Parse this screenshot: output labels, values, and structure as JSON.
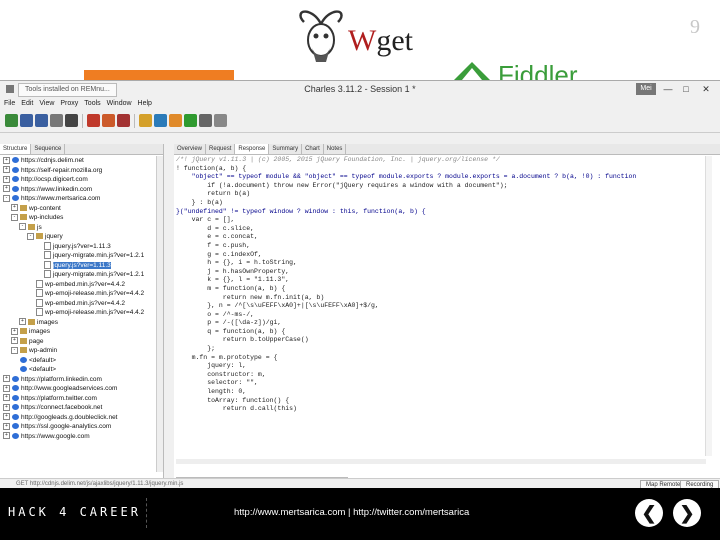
{
  "slide": {
    "logo_top": "Wget",
    "logo_right": "Fiddler",
    "slide_number": "9"
  },
  "window": {
    "tab_label": "Tools installed on REMnu...",
    "title": "Charles 3.11.2 - Session 1 *",
    "user_badge": "Mei",
    "controls": [
      "—",
      "□",
      "✕"
    ]
  },
  "menu": [
    "File",
    "Edit",
    "View",
    "Proxy",
    "Tools",
    "Window",
    "Help"
  ],
  "toolbar_icons": [
    {
      "name": "new-session-icon",
      "color": "#3a8a3a"
    },
    {
      "name": "open-session-icon",
      "color": "#3a5fa0"
    },
    {
      "name": "save-session-icon",
      "color": "#3a5fa0"
    },
    {
      "name": "trash-icon",
      "color": "#777777"
    },
    {
      "name": "binoculars-icon",
      "color": "#444444"
    },
    {
      "name": "sep"
    },
    {
      "name": "record-icon",
      "color": "#c0392b"
    },
    {
      "name": "throttle-icon",
      "color": "#cc5a2a"
    },
    {
      "name": "stop-icon",
      "color": "#a33333"
    },
    {
      "name": "sep"
    },
    {
      "name": "edit-icon",
      "color": "#d4a02a"
    },
    {
      "name": "repeat-icon",
      "color": "#2b7bb9"
    },
    {
      "name": "pencil-icon",
      "color": "#e08a2a"
    },
    {
      "name": "validate-icon",
      "color": "#2f9a2f"
    },
    {
      "name": "tools-icon",
      "color": "#666666"
    },
    {
      "name": "settings-icon",
      "color": "#888888"
    }
  ],
  "left_tabs": [
    "Structure",
    "Sequence"
  ],
  "tree": [
    {
      "d": 0,
      "e": "+",
      "i": "globe",
      "t": "https://cdnjs.delim.net"
    },
    {
      "d": 0,
      "e": "+",
      "i": "globe",
      "t": "https://self-repair.mozilla.org"
    },
    {
      "d": 0,
      "e": "+",
      "i": "globe",
      "t": "http://ocsp.digicert.com"
    },
    {
      "d": 0,
      "e": "+",
      "i": "globe",
      "t": "https://www.linkedin.com"
    },
    {
      "d": 0,
      "e": "-",
      "i": "globe",
      "t": "https://www.mertsarica.com"
    },
    {
      "d": 1,
      "e": "+",
      "i": "folder",
      "t": "wp-content"
    },
    {
      "d": 1,
      "e": "-",
      "i": "folder",
      "t": "wp-includes"
    },
    {
      "d": 2,
      "e": "-",
      "i": "folder",
      "t": "js"
    },
    {
      "d": 3,
      "e": "-",
      "i": "folder",
      "t": "jquery"
    },
    {
      "d": 4,
      "e": "",
      "i": "file",
      "t": "jquery.js?ver=1.11.3"
    },
    {
      "d": 4,
      "e": "",
      "i": "file",
      "t": "jquery-migrate.min.js?ver=1.2.1"
    },
    {
      "d": 4,
      "e": "",
      "i": "file",
      "t": "jquery.js?ver=1.11.3",
      "sel": true
    },
    {
      "d": 4,
      "e": "",
      "i": "file",
      "t": "jquery-migrate.min.js?ver=1.2.1"
    },
    {
      "d": 3,
      "e": "",
      "i": "file",
      "t": "wp-embed.min.js?ver=4.4.2"
    },
    {
      "d": 3,
      "e": "",
      "i": "file",
      "t": "wp-emoji-release.min.js?ver=4.4.2"
    },
    {
      "d": 3,
      "e": "",
      "i": "file",
      "t": "wp-embed.min.js?ver=4.4.2"
    },
    {
      "d": 3,
      "e": "",
      "i": "file",
      "t": "wp-emoji-release.min.js?ver=4.4.2"
    },
    {
      "d": 2,
      "e": "+",
      "i": "folder",
      "t": "images"
    },
    {
      "d": 1,
      "e": "+",
      "i": "folder",
      "t": "images"
    },
    {
      "d": 1,
      "e": "+",
      "i": "folder",
      "t": "page"
    },
    {
      "d": 1,
      "e": "-",
      "i": "folder",
      "t": "wp-admin"
    },
    {
      "d": 1,
      "e": "",
      "i": "globe",
      "t": "<default>"
    },
    {
      "d": 1,
      "e": "",
      "i": "globe",
      "t": "<default>"
    },
    {
      "d": 0,
      "e": "+",
      "i": "globe",
      "t": "https://platform.linkedin.com"
    },
    {
      "d": 0,
      "e": "+",
      "i": "globe",
      "t": "http://www.googleadservices.com"
    },
    {
      "d": 0,
      "e": "+",
      "i": "globe",
      "t": "https://platform.twitter.com"
    },
    {
      "d": 0,
      "e": "+",
      "i": "globe",
      "t": "https://connect.facebook.net"
    },
    {
      "d": 0,
      "e": "+",
      "i": "globe",
      "t": "http://googleads.g.doubleclick.net"
    },
    {
      "d": 0,
      "e": "+",
      "i": "globe",
      "t": "https://ssl.google-analytics.com"
    },
    {
      "d": 0,
      "e": "+",
      "i": "globe",
      "t": "https://www.google.com"
    }
  ],
  "right_tabs": [
    "Overview",
    "Request",
    "Response",
    "Summary",
    "Chart",
    "Notes"
  ],
  "right_active": "Response",
  "code": [
    {
      "c": "comment",
      "t": "/*! jQuery v1.11.3 | (c) 2005, 2015 jQuery Foundation, Inc. | jquery.org/license */"
    },
    {
      "c": "",
      "t": "! function(a, b) {"
    },
    {
      "c": "blue",
      "t": "    \"object\" == typeof module && \"object\" == typeof module.exports ? module.exports = a.document ? b(a, !0) : function"
    },
    {
      "c": "",
      "t": "        if (!a.document) throw new Error(\"jQuery requires a window with a document\");"
    },
    {
      "c": "",
      "t": "        return b(a)"
    },
    {
      "c": "",
      "t": "    } : b(a)"
    },
    {
      "c": "blue",
      "t": "}(\"undefined\" != typeof window ? window : this, function(a, b) {"
    },
    {
      "c": "",
      "t": "    var c = [],"
    },
    {
      "c": "",
      "t": "        d = c.slice,"
    },
    {
      "c": "",
      "t": "        e = c.concat,"
    },
    {
      "c": "",
      "t": "        f = c.push,"
    },
    {
      "c": "",
      "t": "        g = c.indexOf,"
    },
    {
      "c": "",
      "t": "        h = {}, i = h.toString,"
    },
    {
      "c": "",
      "t": "        j = h.hasOwnProperty,"
    },
    {
      "c": "",
      "t": "        k = {}, l = \"1.11.3\","
    },
    {
      "c": "",
      "t": "        m = function(a, b) {"
    },
    {
      "c": "",
      "t": "            return new m.fn.init(a, b)"
    },
    {
      "c": "",
      "t": "        }, n = /^[\\s\\uFEFF\\xA0]+|[\\s\\uFEFF\\xA0]+$/g,"
    },
    {
      "c": "",
      "t": "        o = /^-ms-/,"
    },
    {
      "c": "",
      "t": "        p = /-([\\da-z])/gi,"
    },
    {
      "c": "",
      "t": "        q = function(a, b) {"
    },
    {
      "c": "",
      "t": "            return b.toUpperCase()"
    },
    {
      "c": "",
      "t": "        };"
    },
    {
      "c": "",
      "t": "    m.fn = m.prototype = {"
    },
    {
      "c": "",
      "t": "        jquery: l,"
    },
    {
      "c": "",
      "t": "        constructor: m,"
    },
    {
      "c": "",
      "t": "        selector: \"\","
    },
    {
      "c": "",
      "t": "        length: 0,"
    },
    {
      "c": "",
      "t": "        toArray: function() {"
    },
    {
      "c": "",
      "t": "            return d.call(this)"
    }
  ],
  "bottom_tabs": [
    "Headers",
    "Text",
    "Hex",
    "Compressed",
    "JavaScript",
    "Raw"
  ],
  "bottom_active": "JavaScript",
  "status": {
    "url": "GET http://cdnjs.delim.net/js/ajaxlibs/jquery/1.11.3/jquery.min.js",
    "left_button": "Map Remote",
    "right_button": "Recording"
  },
  "footer": {
    "brand": "HACK 4 CAREER",
    "links": "http://www.mertsarica.com | http://twitter.com/mertsarica",
    "prev": "❮",
    "next": "❯"
  }
}
